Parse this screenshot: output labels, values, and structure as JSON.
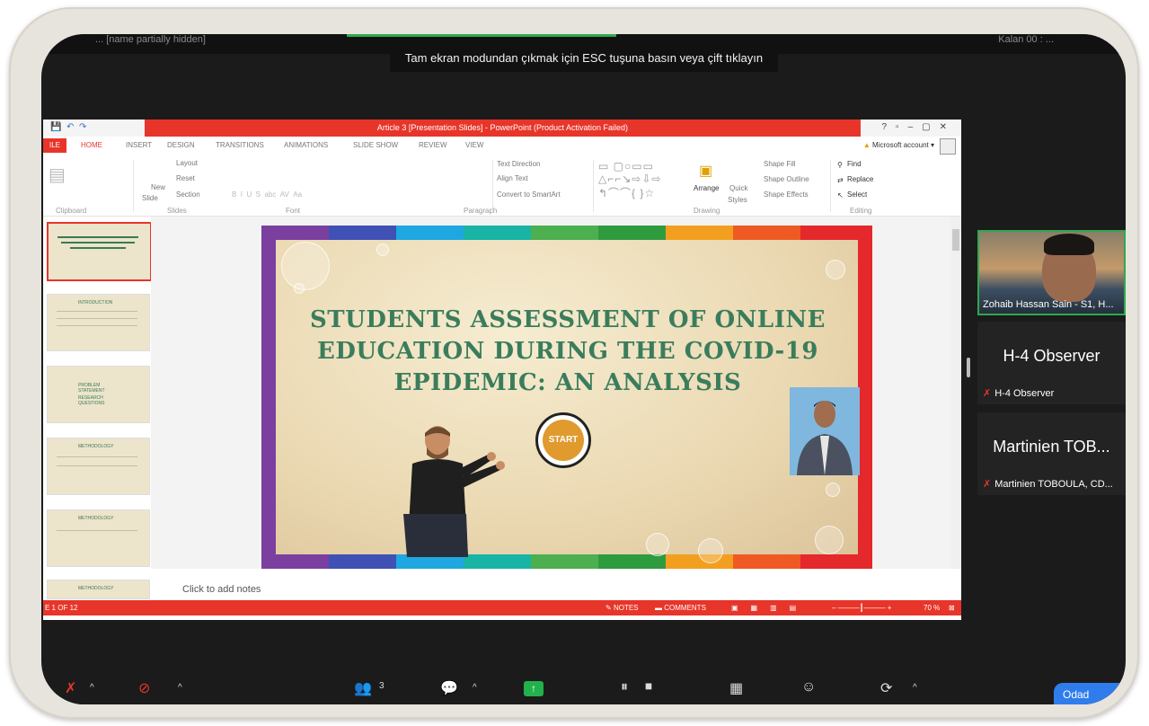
{
  "top_bar": {
    "left_name": "... [name partially hidden]",
    "right_name": "Kalan 00 : ..."
  },
  "esc_banner": "Tam ekran modundan çıkmak için ESC tuşuna basın veya çift tıklayın",
  "powerpoint": {
    "window_title": "Article 3 [Presentation Slides] - PowerPoint (Product Activation Failed)",
    "file_tab": "ILE",
    "tabs": [
      "HOME",
      "INSERT",
      "DESIGN",
      "TRANSITIONS",
      "ANIMATIONS",
      "SLIDE SHOW",
      "REVIEW",
      "VIEW"
    ],
    "account": "Microsoft account",
    "ribbon": {
      "slides_items": [
        "Layout",
        "Reset",
        "New",
        "Slide",
        "Section"
      ],
      "paragraph_items": [
        "Text Direction",
        "Align Text",
        "Convert to SmartArt"
      ],
      "drawing_items": [
        "Arrange",
        "Quick",
        "Styles",
        "Shape Fill",
        "Shape Outline",
        "Shape Effects"
      ],
      "editing_items": [
        "Find",
        "Replace",
        "Select"
      ],
      "groups": [
        "Clipboard",
        "Slides",
        "Font",
        "Paragraph",
        "Drawing",
        "Editing"
      ]
    },
    "slide": {
      "title_lines": [
        "STUDENTS ASSESSMENT OF ONLINE",
        "EDUCATION DURING THE COVID-19",
        "EPIDEMIC: AN ANALYSIS"
      ],
      "start_button": "START"
    },
    "thumbnail_titles": [
      "INTRODUCTION",
      "PROBLEM STATEMENT",
      "RESEARCH QUESTIONS",
      "METHODOLOGY",
      "METHODOLOGY",
      "METHODOLOGY"
    ],
    "notes_placeholder": "Click to add notes",
    "status": {
      "slide_counter": "E 1 OF 12",
      "notes": "NOTES",
      "comments": "COMMENTS",
      "zoom": "70 %"
    }
  },
  "participants": [
    {
      "name": "Zohaib Hassan Sain - S1, H...",
      "video": true
    },
    {
      "display": "H-4 Observer",
      "name": "H-4 Observer",
      "muted": true
    },
    {
      "display": "Martinien TOB...",
      "name": "Martinien TOBOULA, CD...",
      "muted": true
    }
  ],
  "toolbar": {
    "participant_count": "3",
    "room_button": "Odad"
  }
}
